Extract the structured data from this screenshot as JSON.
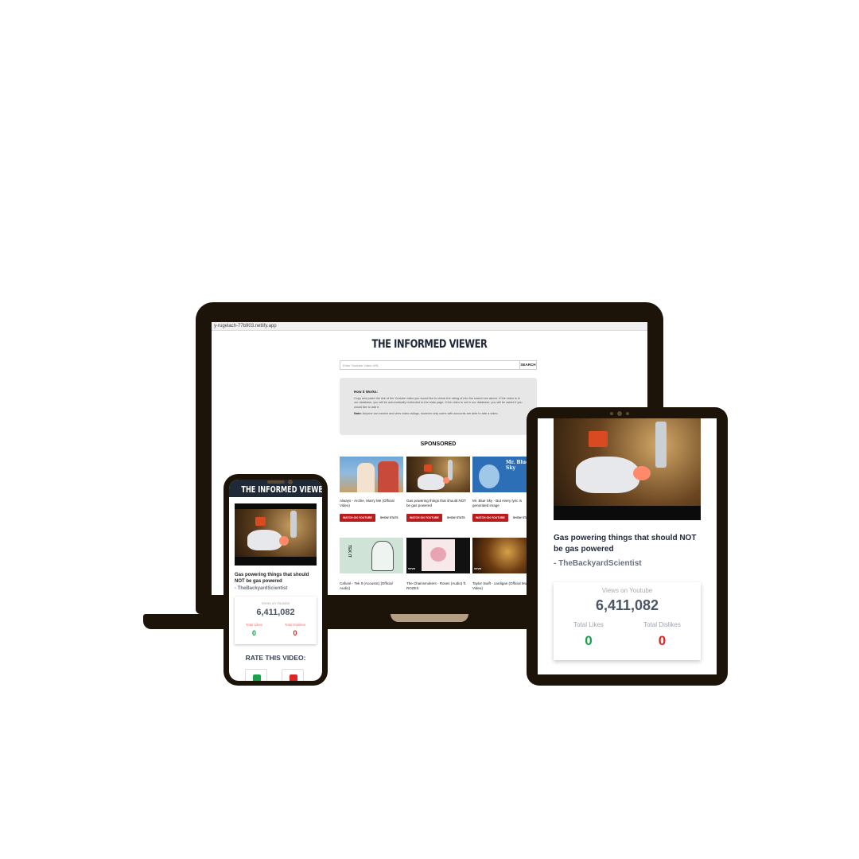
{
  "site": {
    "title": "THE INFORMED VIEWER",
    "url": "y-rugelach-77b903.netlify.app"
  },
  "search": {
    "placeholder": "Enter Youtube Video URL",
    "button": "SEARCH"
  },
  "how": {
    "heading": "How it Works:",
    "text": "Copy and paste the link of the Youtube video you would like to check the rating of into the search bar above. If the video is in our database, you will be automatically redirected to the stats page. If the video is not in our database, you will be asked if you would like to add it.",
    "note_label": "Note:",
    "note_text": "Anyone can search and view video ratings, however only users with accounts are able to rate a video."
  },
  "sponsored": {
    "heading": "SPONSORED",
    "watch_label": "WATCH ON YOUTUBE",
    "stats_label": "SHOW STATS",
    "cards": [
      {
        "title": "Always - Archie, Marry Me (Official Video)"
      },
      {
        "title": "Gas powering things that should NOT be gas powered"
      },
      {
        "title": "Mr. Blue Sky - But every lyric is generated image"
      },
      {
        "title": "Cafuné - Tek It (Acoustic) [Official Audio]"
      },
      {
        "title": "The Chainsmokers - Roses (Audio) ft. ROZES"
      },
      {
        "title": "Taylor Swift - cardigan (Official Music Video)"
      }
    ]
  },
  "video": {
    "title": "Gas powering things that should NOT be gas powered",
    "channel": "- TheBackyardScientist",
    "channel_phone": "- TheBackyardScientist",
    "views_label": "Views on Youtube",
    "views": "6,411,082",
    "likes_label": "Total Likes",
    "dislikes_label": "Total Dislikes",
    "likes": "0",
    "dislikes": "0"
  },
  "rate": {
    "heading": "RATE THIS VIDEO:"
  },
  "colors": {
    "device_frame": "#1c1409",
    "accent_red": "#b91c1c",
    "like_green": "#16a34a",
    "dislike_red": "#dc2626",
    "header_dark": "#1f2937"
  }
}
